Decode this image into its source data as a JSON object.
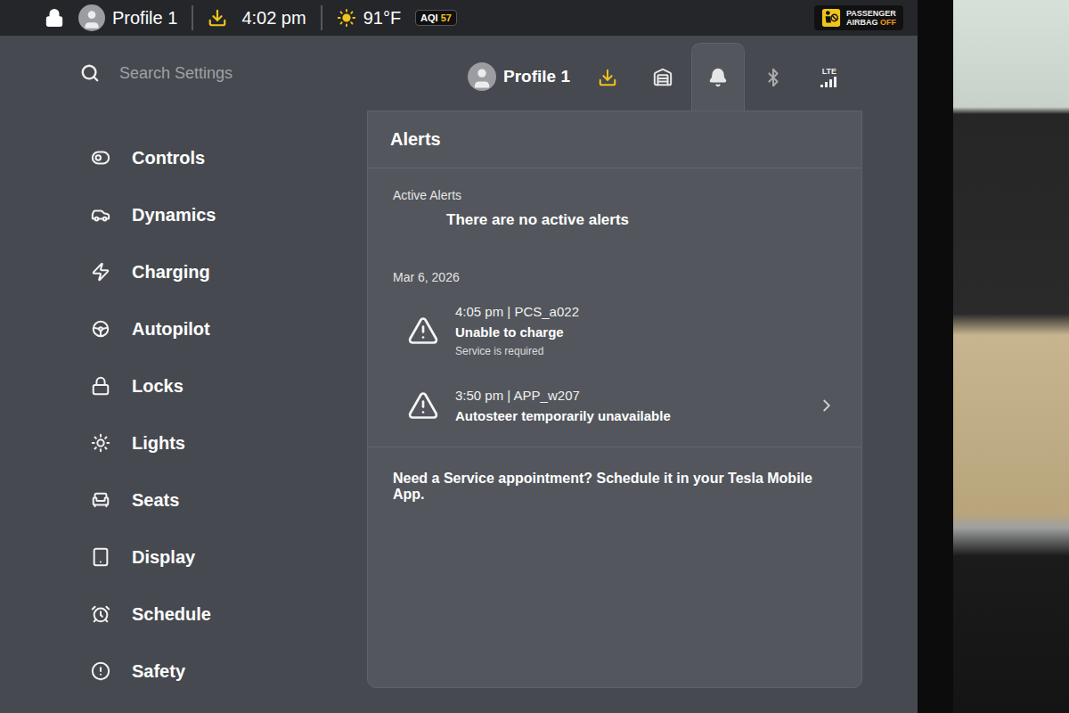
{
  "status_bar": {
    "profile": "Profile 1",
    "time": "4:02 pm",
    "temperature": "91°F",
    "aqi_label": "AQI",
    "aqi_value": "57",
    "airbag_top": "PASSENGER",
    "airbag_word": "AIRBAG",
    "airbag_state": "OFF"
  },
  "header": {
    "search_placeholder": "Search Settings",
    "profile": "Profile 1",
    "tabs": [
      {
        "kind": "download",
        "selected": false
      },
      {
        "kind": "garage",
        "selected": false
      },
      {
        "kind": "alerts",
        "selected": true
      },
      {
        "kind": "bluetooth",
        "selected": false
      },
      {
        "kind": "lte",
        "label": "LTE",
        "selected": false
      }
    ]
  },
  "sidebar": {
    "items": [
      {
        "label": "Controls",
        "kind": "controls"
      },
      {
        "label": "Dynamics",
        "kind": "dynamics"
      },
      {
        "label": "Charging",
        "kind": "charging"
      },
      {
        "label": "Autopilot",
        "kind": "autopilot"
      },
      {
        "label": "Locks",
        "kind": "locks"
      },
      {
        "label": "Lights",
        "kind": "lights"
      },
      {
        "label": "Seats",
        "kind": "seats"
      },
      {
        "label": "Display",
        "kind": "display"
      },
      {
        "label": "Schedule",
        "kind": "schedule"
      },
      {
        "label": "Safety",
        "kind": "safety"
      }
    ]
  },
  "alerts": {
    "title": "Alerts",
    "active_heading": "Active Alerts",
    "active_empty": "There are no active alerts",
    "date": "Mar 6, 2026",
    "items": [
      {
        "meta": "4:05 pm | PCS_a022",
        "title": "Unable to charge",
        "detail": "Service is required",
        "expandable": false
      },
      {
        "meta": "3:50 pm | APP_w207",
        "title": "Autosteer temporarily unavailable",
        "expandable": true
      }
    ],
    "footer": "Need a Service appointment? Schedule it in your Tesla Mobile App."
  }
}
